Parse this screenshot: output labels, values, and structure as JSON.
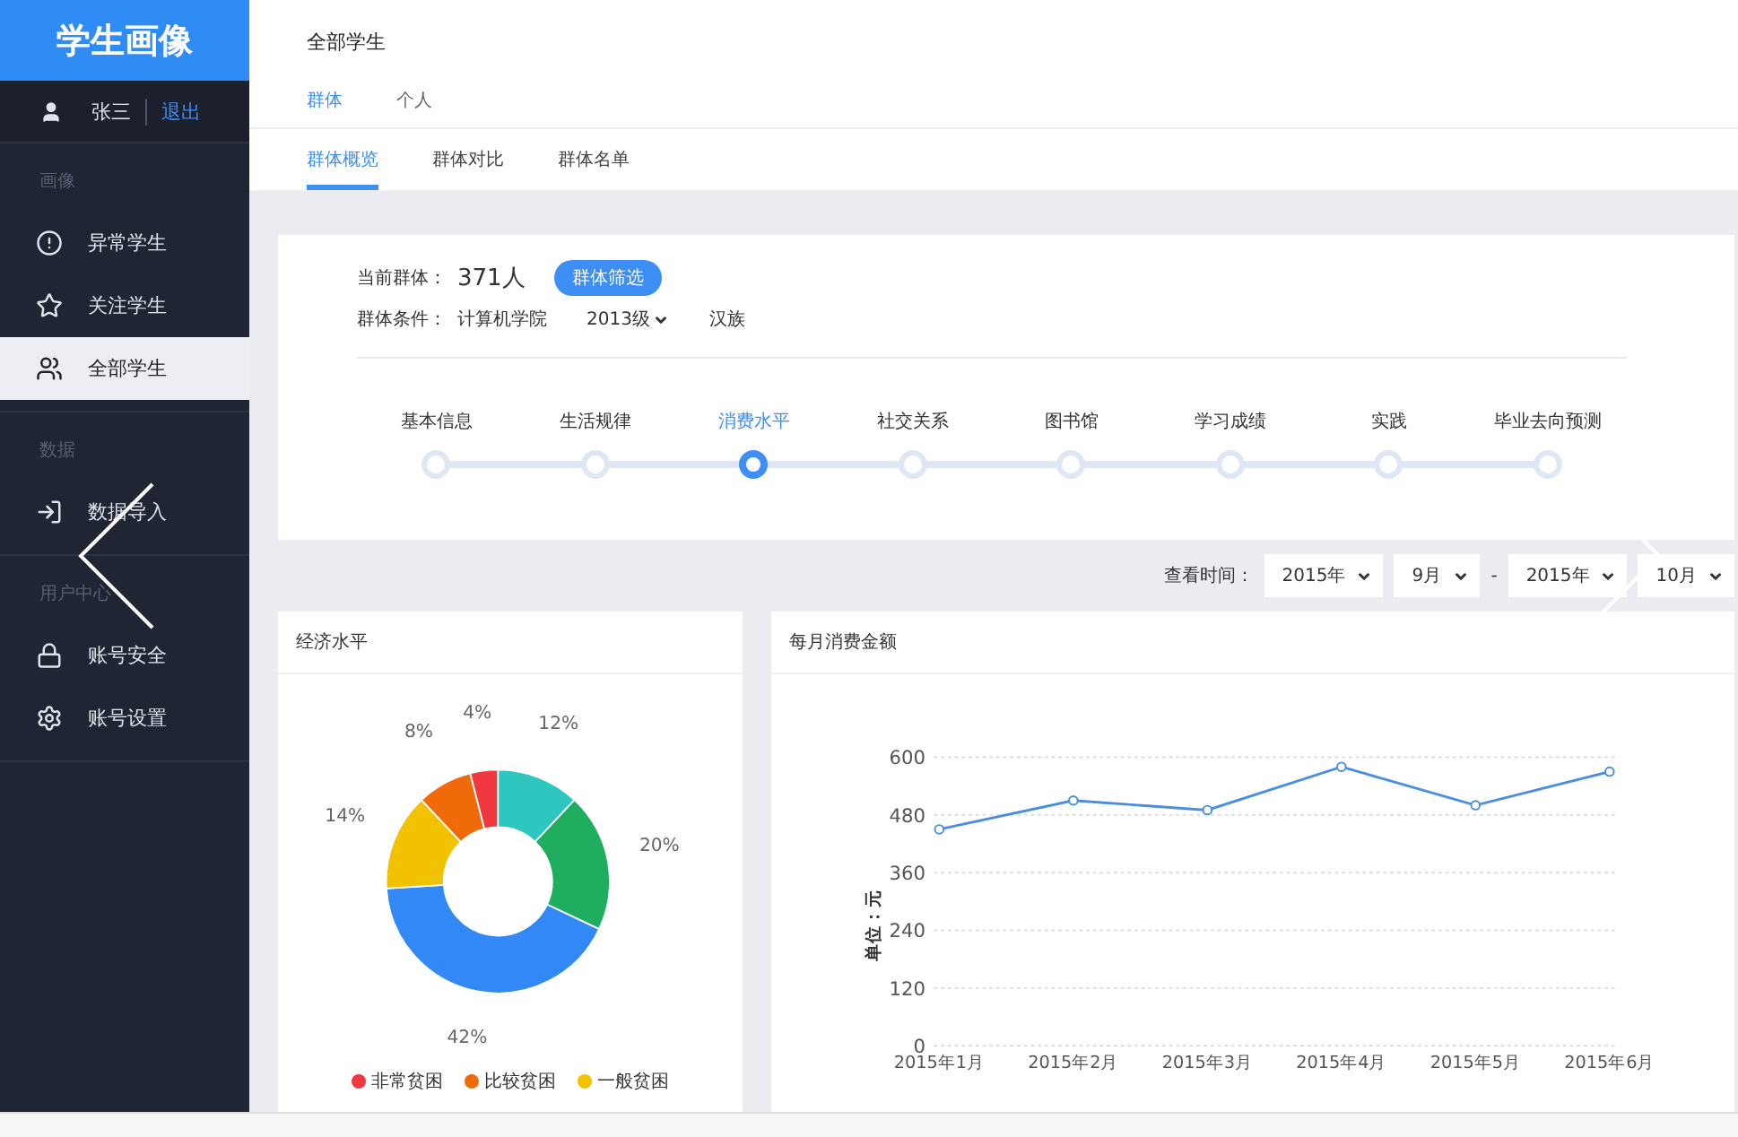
{
  "sidebar": {
    "logo": "学生画像",
    "user": {
      "name": "张三",
      "logout": "退出"
    },
    "sections": [
      {
        "title": "画像",
        "items": [
          {
            "label": "异常学生",
            "selected": false
          },
          {
            "label": "关注学生",
            "selected": false
          },
          {
            "label": "全部学生",
            "selected": true
          }
        ]
      },
      {
        "title": "数据",
        "items": [
          {
            "label": "数据导入",
            "selected": false
          }
        ]
      },
      {
        "title": "用户中心",
        "items": [
          {
            "label": "账号安全",
            "selected": false
          },
          {
            "label": "账号设置",
            "selected": false
          }
        ]
      }
    ]
  },
  "header": {
    "title": "全部学生",
    "tabs": [
      {
        "label": "群体",
        "selected": true
      },
      {
        "label": "个人",
        "selected": false
      }
    ],
    "subtabs": [
      {
        "label": "群体概览",
        "selected": true
      },
      {
        "label": "群体对比",
        "selected": false
      },
      {
        "label": "群体名单",
        "selected": false
      }
    ]
  },
  "group": {
    "current_label": "当前群体：",
    "count": "371人",
    "filter_button": "群体筛选",
    "conditions_label": "群体条件：",
    "conditions": [
      {
        "label": "计算机学院",
        "dropdown": false
      },
      {
        "label": "2013级",
        "dropdown": true
      },
      {
        "label": "汉族",
        "dropdown": false
      }
    ],
    "steps": [
      {
        "label": "基本信息",
        "selected": false
      },
      {
        "label": "生活规律",
        "selected": false
      },
      {
        "label": "消费水平",
        "selected": true
      },
      {
        "label": "社交关系",
        "selected": false
      },
      {
        "label": "图书馆",
        "selected": false
      },
      {
        "label": "学习成绩",
        "selected": false
      },
      {
        "label": "实践",
        "selected": false
      },
      {
        "label": "毕业去向预测",
        "selected": false
      }
    ]
  },
  "time_filter": {
    "label": "查看时间：",
    "selects": [
      "2015年",
      "9月",
      "2015年",
      "10月"
    ],
    "separator": "-"
  },
  "economy_panel": {
    "title": "经济水平",
    "chart_data": {
      "type": "donut",
      "values": [
        12,
        20,
        42,
        14,
        8,
        4
      ],
      "value_labels": [
        "12%",
        "20%",
        "42%",
        "14%",
        "8%",
        "4%"
      ],
      "colors": [
        "#2ec7c0",
        "#1fae5f",
        "#3288f5",
        "#f2c200",
        "#f06a0a",
        "#f2383f"
      ]
    },
    "legend": [
      {
        "label": "非常贫困",
        "color": "#f2383f"
      },
      {
        "label": "比较贫困",
        "color": "#f06a0a"
      },
      {
        "label": "一般贫困",
        "color": "#f2c200"
      }
    ]
  },
  "spending_panel": {
    "title": "每月消费金额",
    "chart_data": {
      "type": "line",
      "ylabel": "单位：元",
      "categories": [
        "2015年1月",
        "2015年2月",
        "2015年3月",
        "2015年4月",
        "2015年5月",
        "2015年6月"
      ],
      "series": [
        {
          "color": "#4a8ee0",
          "marker": "circle",
          "values": [
            450,
            510,
            490,
            580,
            500,
            570
          ]
        }
      ],
      "ylim": [
        0,
        600
      ],
      "yticks": [
        0,
        120,
        240,
        360,
        480,
        600
      ],
      "grid": true
    }
  }
}
